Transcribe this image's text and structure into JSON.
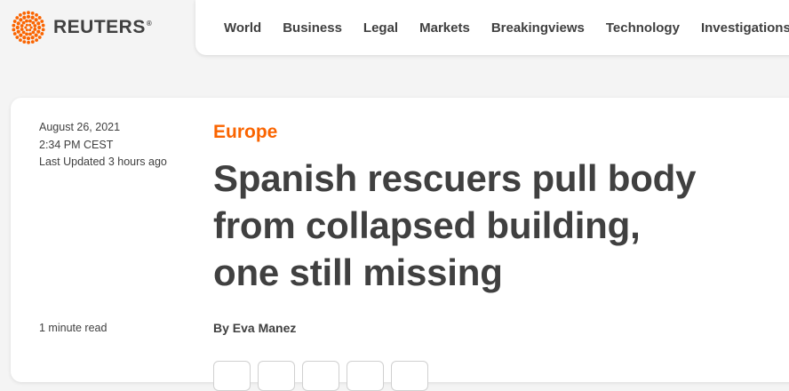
{
  "brand": {
    "name": "REUTERS",
    "registered": "®",
    "accent": "#fa6400"
  },
  "nav": {
    "items": [
      "World",
      "Business",
      "Legal",
      "Markets",
      "Breakingviews",
      "Technology",
      "Investigations"
    ]
  },
  "article": {
    "date": "August 26, 2021",
    "time": "2:34 PM CEST",
    "updated": "Last Updated 3 hours ago",
    "read_time": "1 minute read",
    "section": "Europe",
    "headline": "Spanish rescuers pull body from collapsed building, one still missing",
    "byline_prefix": "By ",
    "author": "Eva Manez"
  },
  "share_buttons": [
    "share-button-1-icon",
    "share-button-2-icon",
    "share-button-3-icon",
    "share-button-4-icon",
    "share-button-5-icon"
  ]
}
